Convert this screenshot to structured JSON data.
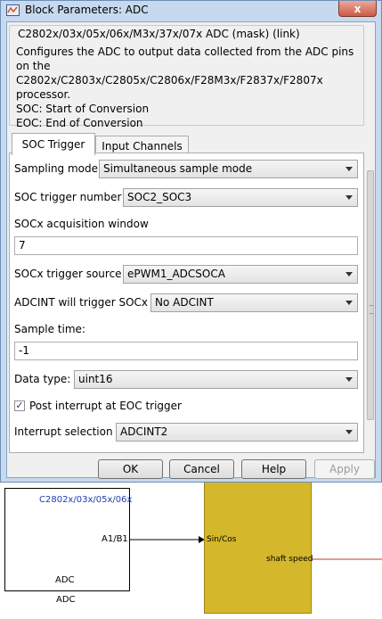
{
  "window": {
    "title": "Block Parameters: ADC",
    "close_glyph": "x"
  },
  "description": {
    "mask_title": "C2802x/03x/05x/06x/M3x/37x/07x ADC (mask) (link)",
    "text": "Configures the ADC to output data collected from the ADC pins on the C2802x/C2803x/C2805x/C2806x/F28M3x/F2837x/F2807x processor.\nSOC: Start of Conversion\nEOC: End of Conversion"
  },
  "tabs": [
    {
      "label": "SOC Trigger",
      "active": true
    },
    {
      "label": "Input Channels",
      "active": false
    }
  ],
  "params": {
    "sampling_mode": {
      "label": "Sampling mode",
      "value": "Simultaneous sample mode"
    },
    "soc_trigger_number": {
      "label": "SOC trigger number",
      "value": "SOC2_SOC3"
    },
    "acq_window": {
      "label": "SOCx acquisition window",
      "value": "7"
    },
    "trigger_source": {
      "label": "SOCx trigger source",
      "value": "ePWM1_ADCSOCA"
    },
    "adcint_trigger": {
      "label": "ADCINT will trigger SOCx",
      "value": "No ADCINT"
    },
    "sample_time": {
      "label": "Sample time:",
      "value": "-1"
    },
    "data_type": {
      "label": "Data type:",
      "value": "uint16"
    },
    "post_interrupt": {
      "label": "Post interrupt at EOC trigger",
      "checked": true,
      "check_glyph": "✓"
    },
    "interrupt_selection": {
      "label": "Interrupt selection",
      "value": "ADCINT2"
    }
  },
  "buttons": {
    "ok": "OK",
    "cancel": "Cancel",
    "help": "Help",
    "apply": "Apply"
  },
  "canvas": {
    "adc_block": {
      "variant": "C2802x/03x/05x/06x",
      "port": "A1/B1",
      "inner_label": "ADC",
      "name": "ADC"
    },
    "subsystem": {
      "input_port": "Sin/Cos",
      "output_port": "shaft speed"
    },
    "colors": {
      "subsystem_fill": "#d4b72a",
      "output_line": "#c0392b",
      "variant_text": "#1a3fb0"
    }
  }
}
